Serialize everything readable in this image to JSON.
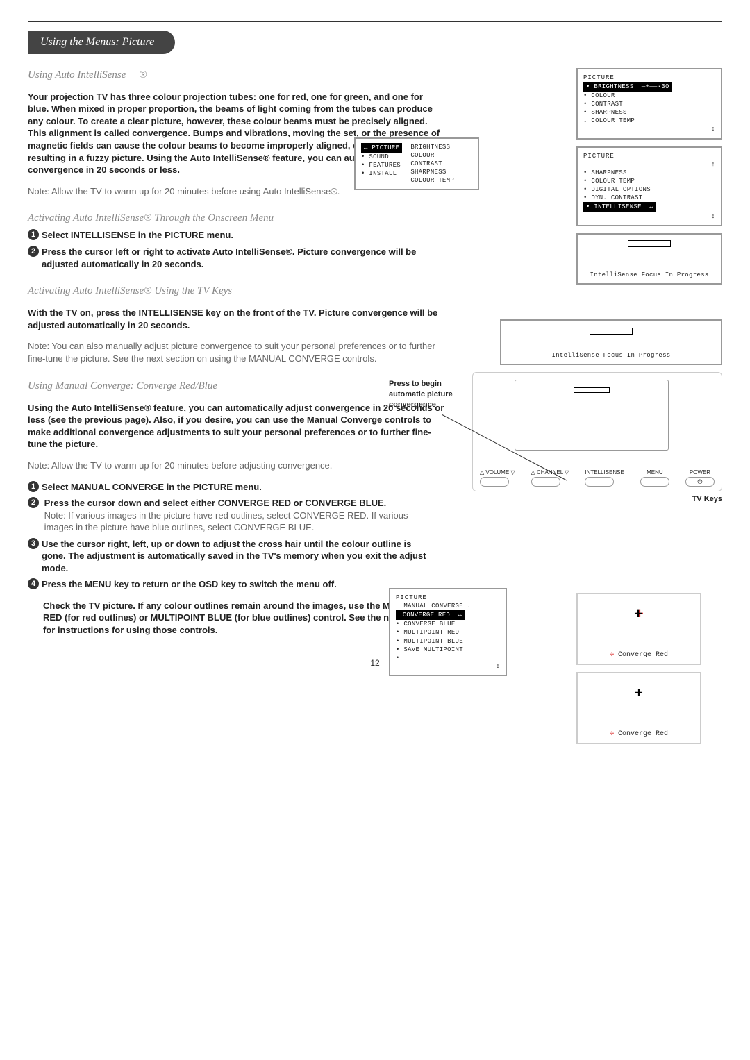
{
  "page": {
    "section_tab": "Using the Menus: Picture",
    "page_number": "12"
  },
  "h1": {
    "title": "Using Auto IntelliSense",
    "reg": "®",
    "para_bold": "Your projection TV has three colour projection tubes: one for red, one for green, and one for blue. When mixed in proper proportion, the beams of light coming from the tubes can produce any colour. To create a clear picture, however, these colour beams must be precisely aligned. This alignment is called convergence. Bumps and vibrations, moving the set, or the presence of magnetic fields can cause the colour beams to become improperly aligned, or misconverged, resulting in a fuzzy picture. Using the Auto IntelliSense® feature, you can automatically adjust convergence in 20 seconds or less.",
    "note": "Note: Allow the TV to warm up for 20 minutes before using Auto IntelliSense®."
  },
  "h2": {
    "title": "Activating Auto IntelliSense® Through the Onscreen Menu",
    "s1": "Select INTELLISENSE in the PICTURE menu.",
    "s2": "Press the cursor left or right to activate Auto IntelliSense®. Picture convergence will be adjusted automatically in 20 seconds."
  },
  "h3": {
    "title": "Activating Auto IntelliSense® Using the TV Keys",
    "bold": "With the TV on, press the INTELLISENSE key on the front of the TV. Picture convergence will be adjusted automatically in 20 seconds.",
    "note": "Note: You can also manually adjust picture convergence to suit your personal preferences or to further fine-tune the picture. See the next section on using the MANUAL CONVERGE controls.",
    "annot": "Press to begin automatic picture convergence",
    "tv_keys_label": "TV Keys",
    "btn_volume": "△ VOLUME ▽",
    "btn_channel": "△ CHANNEL ▽",
    "btn_intelli": "INTELLISENSE",
    "btn_menu": "MENU",
    "btn_power": "POWER"
  },
  "h4": {
    "title": "Using Manual Converge: Converge Red/Blue",
    "bold": "Using the Auto IntelliSense® feature, you can automatically adjust convergence in 20 seconds or less (see the previous page). Also, if you desire, you can use the Manual Converge controls to make additional convergence adjustments to suit your personal preferences or to further fine-tune the picture.",
    "note": "Note: Allow the TV to warm up for 20 minutes before adjusting convergence.",
    "s1": "Select MANUAL CONVERGE in the PICTURE menu.",
    "s2a": "Press the cursor down and select either CONVERGE RED or CONVERGE BLUE.",
    "s2b": "Note: If various images in the picture have red outlines, select CONVERGE RED. If various images in the picture have blue outlines, select CONVERGE BLUE.",
    "s3": "Use the cursor right, left, up or down to adjust the cross hair until the colour outline is gone. The adjustment is automatically saved in the TV's memory when you exit the adjust mode.",
    "s4": "Press the MENU key to return or the OSD key to switch the menu off.",
    "tail": "Check the TV picture. If any colour outlines remain around the images, use the MULTIPOINT RED (for red outlines) or MULTIPOINT BLUE (for blue outlines) control. See the next section for instructions for using those controls."
  },
  "osd1": {
    "title": "PICTURE",
    "brightness": "BRIGHTNESS",
    "brightness_val": "30",
    "items": [
      "COLOUR",
      "CONTRAST",
      "SHARPNESS",
      "COLOUR TEMP"
    ]
  },
  "osd2": {
    "title": "PICTURE",
    "items": [
      "SHARPNESS",
      "COLOUR TEMP",
      "DIGITAL OPTIONS",
      "DYN. CONTRAST"
    ],
    "sel": "INTELLISENSE"
  },
  "osd3_text": "IntelliSense Focus In Progress",
  "osd_main": {
    "left_sel": "PICTURE",
    "left": [
      "SOUND",
      "FEATURES",
      "INSTALL"
    ],
    "right": [
      "BRIGHTNESS",
      "COLOUR",
      "CONTRAST",
      "SHARPNESS",
      "COLOUR TEMP"
    ]
  },
  "osd_manual": {
    "title": "PICTURE",
    "head": "MANUAL CONVERGE .",
    "sel": "CONVERGE RED",
    "items": [
      "CONVERGE BLUE",
      "MULTIPOINT RED",
      "MULTIPOINT BLUE",
      "SAVE MULTIPOINT"
    ]
  },
  "conv_caption": "Converge Red"
}
